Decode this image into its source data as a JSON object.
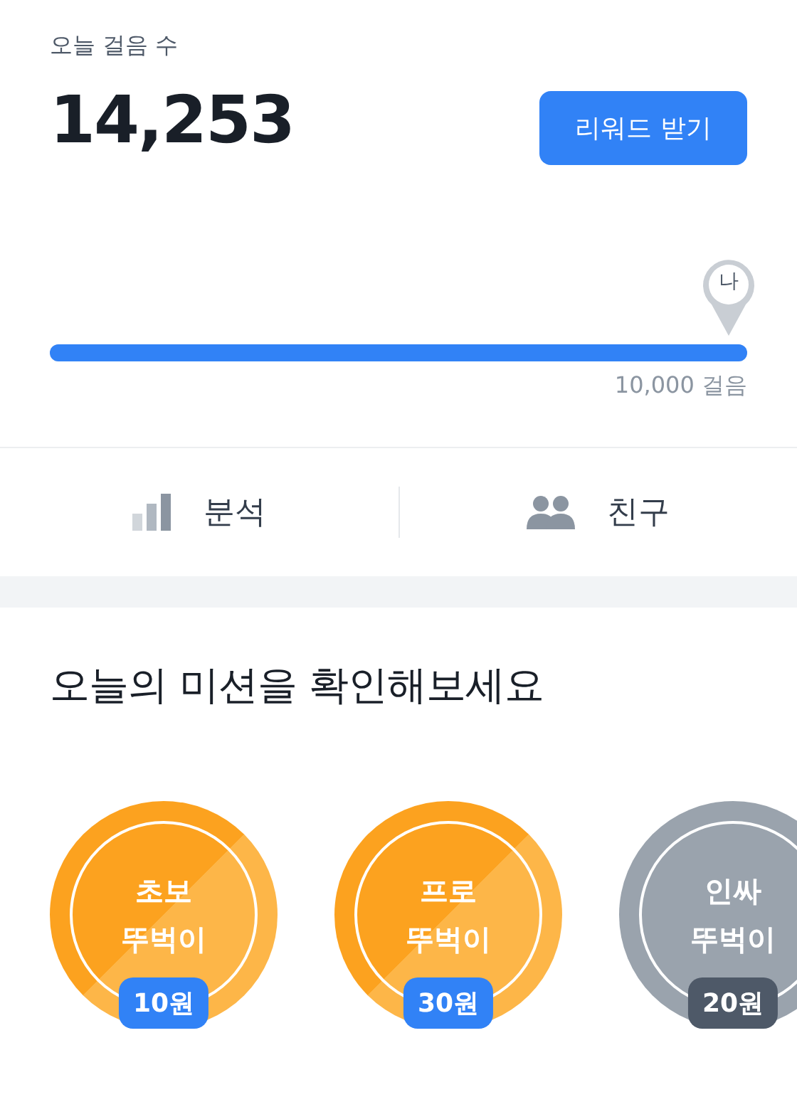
{
  "steps": {
    "label": "오늘 걸음 수",
    "count": "14,253"
  },
  "reward_button": "리워드 받기",
  "progress": {
    "level": 1.0,
    "marker": "나",
    "goal": "10,000 걸음"
  },
  "tabs": [
    {
      "label": "분석",
      "kind": "chart"
    },
    {
      "label": "친구",
      "kind": "friends"
    }
  ],
  "missions": {
    "title": "오늘의 미션을 확인해보세요",
    "items": [
      {
        "name": "초보\n뚜벅이",
        "reward": "10원",
        "kind": "active"
      },
      {
        "name": "프로\n뚜벅이",
        "reward": "30원",
        "kind": "active"
      },
      {
        "name": "인싸\n뚜벅이",
        "reward": "20원",
        "kind": "inactive"
      }
    ]
  }
}
